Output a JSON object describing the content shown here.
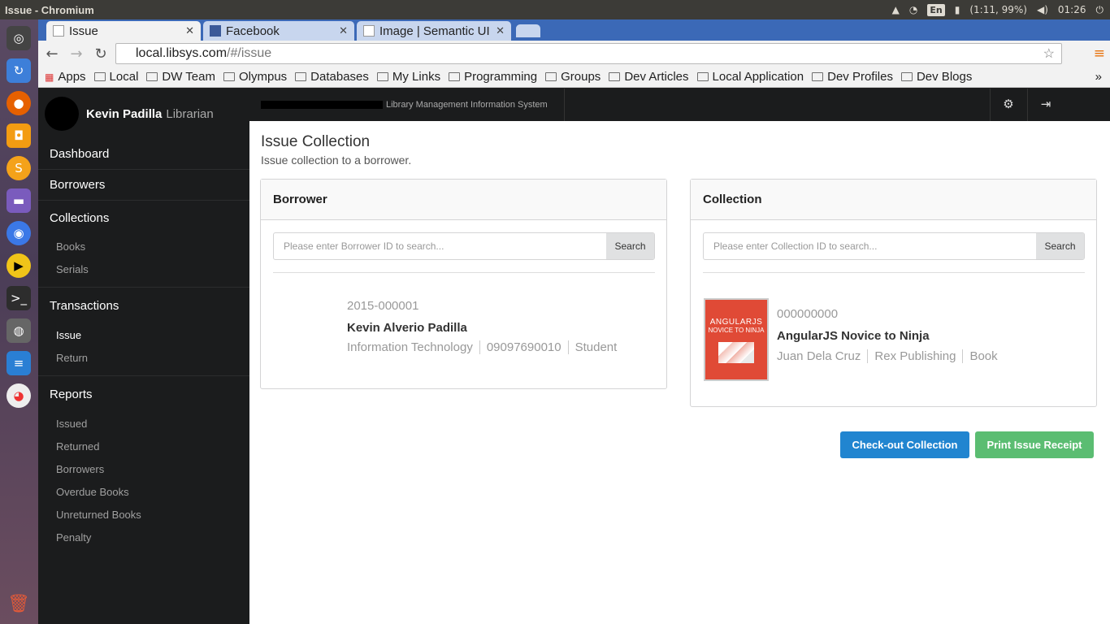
{
  "system": {
    "window_title": "Issue - Chromium",
    "lang": "En",
    "battery": "(1:11, 99%)",
    "clock": "01:26"
  },
  "browser": {
    "tabs": [
      {
        "label": "Issue"
      },
      {
        "label": "Facebook"
      },
      {
        "label": "Image | Semantic UI"
      }
    ],
    "url_host": "local.libsys.com",
    "url_path": "/#/issue",
    "bookmarks": [
      "Apps",
      "Local",
      "DW Team",
      "Olympus",
      "Databases",
      "My Links",
      "Programming",
      "Groups",
      "Dev Articles",
      "Local Application",
      "Dev Profiles",
      "Dev Blogs"
    ],
    "more": "»"
  },
  "user": {
    "name": "Kevin Padilla",
    "role": "Librarian"
  },
  "app": {
    "brand": "Library Management Information System"
  },
  "sidebar": {
    "dashboard": "Dashboard",
    "borrowers": "Borrowers",
    "collections": {
      "title": "Collections",
      "items": [
        "Books",
        "Serials"
      ]
    },
    "transactions": {
      "title": "Transactions",
      "items": [
        "Issue",
        "Return"
      ]
    },
    "reports": {
      "title": "Reports",
      "items": [
        "Issued",
        "Returned",
        "Borrowers",
        "Overdue Books",
        "Unreturned Books",
        "Penalty"
      ]
    }
  },
  "page": {
    "title": "Issue Collection",
    "subtitle": "Issue collection to a borrower."
  },
  "borrower_panel": {
    "title": "Borrower",
    "placeholder": "Please enter Borrower ID to search...",
    "search": "Search",
    "id": "2015-000001",
    "name": "Kevin Alverio Padilla",
    "details": [
      "Information Technology",
      "09097690010",
      "Student"
    ]
  },
  "collection_panel": {
    "title": "Collection",
    "placeholder": "Please enter Collection ID to search...",
    "search": "Search",
    "id": "000000000",
    "name": "AngularJS Novice to Ninja",
    "details": [
      "Juan Dela Cruz",
      "Rex Publishing",
      "Book"
    ],
    "cover_title": "ANGULARJS",
    "cover_subtitle": "NOVICE TO NINJA"
  },
  "actions": {
    "checkout": "Check-out Collection",
    "print": "Print Issue Receipt"
  },
  "colors": {
    "checkout": "#2185d0",
    "print": "#5bbd72",
    "tabbar": "#3b69b7"
  }
}
